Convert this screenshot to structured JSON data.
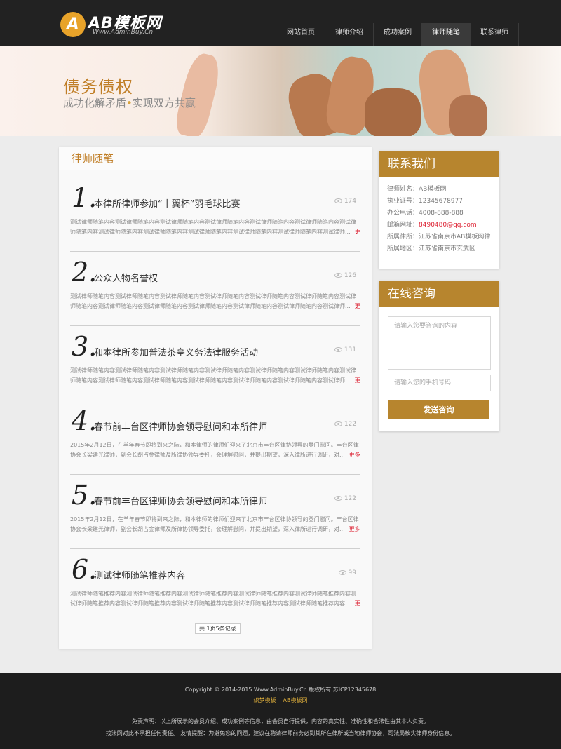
{
  "header": {
    "logo_badge": "A",
    "logo_text": "AB模板网",
    "logo_sub": "Www.AdminBuy.Cn",
    "nav": [
      "网站首页",
      "律师介绍",
      "成功案例",
      "律师随笔",
      "联系律师"
    ],
    "nav_active": 3
  },
  "banner": {
    "title": "债务债权",
    "sub_left": "成功化解矛盾",
    "sub_dot": "•",
    "sub_right": "实现双方共赢"
  },
  "main": {
    "heading": "律师随笔",
    "more_label": "更多>>",
    "articles": [
      {
        "num": "1.",
        "title": "本律所律师参加“丰翼杯”羽毛球比赛",
        "views": "174",
        "text": "测试律师随笔内容测试律师随笔内容测试律师随笔内容测试律师随笔内容测试律师随笔内容测试律师随笔内容测试律师随笔内容测试律师随笔内容测试律师随笔内容测试律师随笔内容测试律师随笔内容测试律师随笔内容测试律师..."
      },
      {
        "num": "2.",
        "title": "公众人物名誉权",
        "views": "126",
        "text": "测试律师随笔内容测试律师随笔内容测试律师随笔内容测试律师随笔内容测试律师随笔内容测试律师随笔内容测试律师随笔内容测试律师随笔内容测试律师随笔内容测试律师随笔内容测试律师随笔内容测试律师随笔内容测试律师..."
      },
      {
        "num": "3.",
        "title": "和本律所参加普法茶亭义务法律服务活动",
        "views": "131",
        "text": "测试律师随笔内容测试律师随笔内容测试律师随笔内容测试律师随笔内容测试律师随笔内容测试律师随笔内容测试律师随笔内容测试律师随笔内容测试律师随笔内容测试律师随笔内容测试律师随笔内容测试律师随笔内容测试律师..."
      },
      {
        "num": "4.",
        "title": "春节前丰台区律师协会领导慰问和本所律师",
        "views": "122",
        "text": "2015年2月12日，在羊年春节即将到来之际，和本律师的律师们迎来了北京市丰台区律协领导的登门慰问。丰台区律协会长梁建光律师，副会长胡占金律师及所律协领导委托，会理解慰问，并提出期望，深入律所进行调研，对..."
      },
      {
        "num": "5.",
        "title": "春节前丰台区律师协会领导慰问和本所律师",
        "views": "122",
        "text": "2015年2月12日，在羊年春节即将到来之际，和本律师的律师们迎来了北京市丰台区律协领导的登门慰问。丰台区律协会长梁建光律师，副会长胡占金律师及所律协领导委托，会理解慰问，并提出期望，深入律所进行调研，对..."
      },
      {
        "num": "6.",
        "title": "测试律师随笔推荐内容",
        "views": "99",
        "text": "测试律师随笔推荐内容测试律师随笔推荐内容测试律师随笔推荐内容测试律师随笔推荐内容测试律师随笔推荐内容测试律师随笔推荐内容测试律师随笔推荐内容测试律师随笔推荐内容测试律师随笔推荐内容测试律师随笔推荐内容..."
      }
    ],
    "pager": "共 1页5条记录"
  },
  "contact": {
    "heading": "联系我们",
    "rows": [
      {
        "label": "律师姓名：",
        "value": "AB模板网"
      },
      {
        "label": "执业证号：",
        "value": "12345678977"
      },
      {
        "label": "办公电话：",
        "value": "4008-888-888"
      },
      {
        "label": "邮箱网址：",
        "value": "8490480@qq.com"
      },
      {
        "label": "所属律所：",
        "value": "江苏省南京市AB模板网律"
      },
      {
        "label": "所属地区：",
        "value": "江苏省南京市玄武区"
      }
    ]
  },
  "consult": {
    "heading": "在线咨询",
    "content_placeholder": "请输入您要咨询的内容",
    "phone_placeholder": "请输入您的手机号码",
    "submit_label": "发送咨询"
  },
  "footer": {
    "copyright": "Copyright © 2014-2015 Www.AdminBuy.Cn 版权所有  苏ICP12345678",
    "links": [
      "织梦模板",
      "AB模板网"
    ],
    "note1": "免责声明：以上所展示的会员介绍、成功案例等信息，由会员自行提供，内容的真实性、准确性和合法性由其本人负责。",
    "note2": "找法网对此不承担任何责任。 友情提醒：为避免您的问题，建议在聘请律师前务必到其所在律所或当地律师协会，司法局核实律师身份信息。"
  },
  "colors": {
    "accent": "#b7852e",
    "header_bg": "#222222",
    "footer_bg": "#1d1d1d",
    "more_link": "#dd2233"
  }
}
